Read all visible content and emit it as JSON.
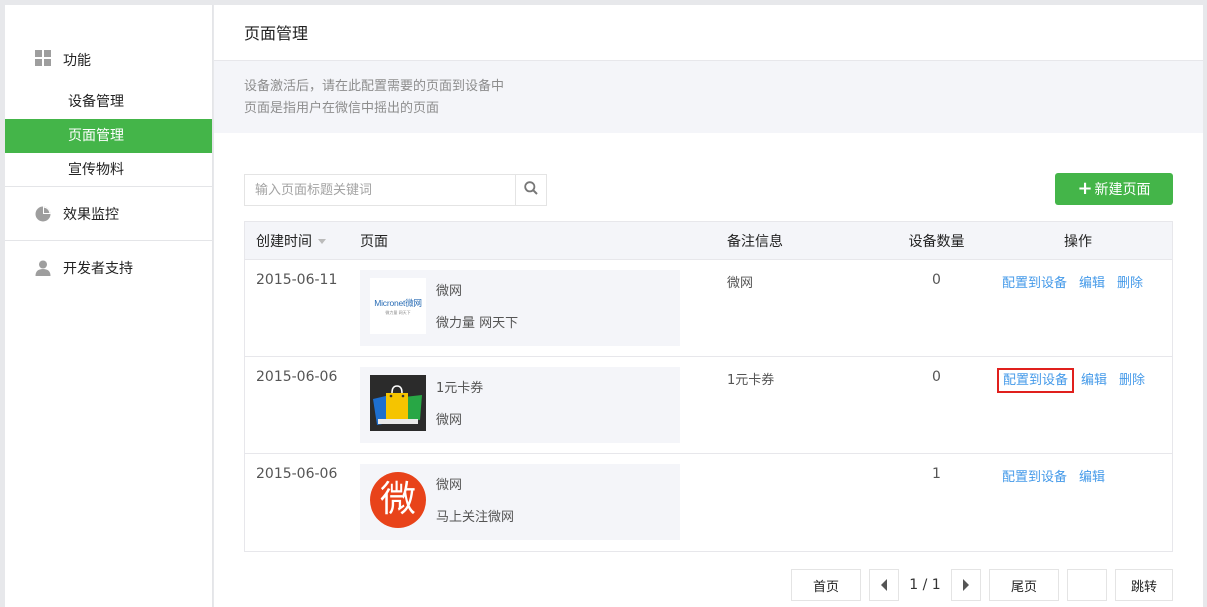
{
  "sidebar": {
    "sections": [
      {
        "label": "功能",
        "icon": "grid-icon",
        "items": [
          {
            "label": "设备管理",
            "active": false
          },
          {
            "label": "页面管理",
            "active": true
          },
          {
            "label": "宣传物料",
            "active": false
          }
        ]
      },
      {
        "label": "效果监控",
        "icon": "pie-chart-icon"
      },
      {
        "label": "开发者支持",
        "icon": "user-icon"
      }
    ]
  },
  "main": {
    "title": "页面管理",
    "notice": [
      "设备激活后，请在此配置需要的页面到设备中",
      "页面是指用户在微信中摇出的页面"
    ],
    "search_placeholder": "输入页面标题关键词",
    "new_button": "新建页面",
    "new_button_icon": "plus-icon"
  },
  "table": {
    "headers": {
      "time": "创建时间",
      "page": "页面",
      "note": "备注信息",
      "count": "设备数量",
      "op": "操作"
    },
    "rows": [
      {
        "time": "2015-06-11",
        "thumb": "micronet-logo",
        "thumb_text": "Micronet微网",
        "thumb_sub": "微力量 网天下",
        "title": "微网",
        "desc": "微力量 网天下",
        "note": "微网",
        "count": "0",
        "actions": [
          "配置到设备",
          "编辑",
          "删除"
        ]
      },
      {
        "time": "2015-06-06",
        "thumb": "coupon-bags-image",
        "title": "1元卡券",
        "desc": "微网",
        "note": "1元卡券",
        "count": "0",
        "actions": [
          "配置到设备",
          "编辑",
          "删除"
        ],
        "highlighted_action": 0
      },
      {
        "time": "2015-06-06",
        "thumb": "wei-logo",
        "thumb_text": "微",
        "title": "微网",
        "desc": "马上关注微网",
        "note": "",
        "count": "1",
        "actions": [
          "配置到设备",
          "编辑"
        ]
      }
    ]
  },
  "pager": {
    "first": "首页",
    "page": "1 / 1",
    "last": "尾页",
    "jump": "跳转"
  },
  "colors": {
    "accent_green": "#44b549",
    "link_blue": "#459ae9",
    "highlight_red": "#e0201d",
    "wei_logo_red": "#e8431a"
  }
}
